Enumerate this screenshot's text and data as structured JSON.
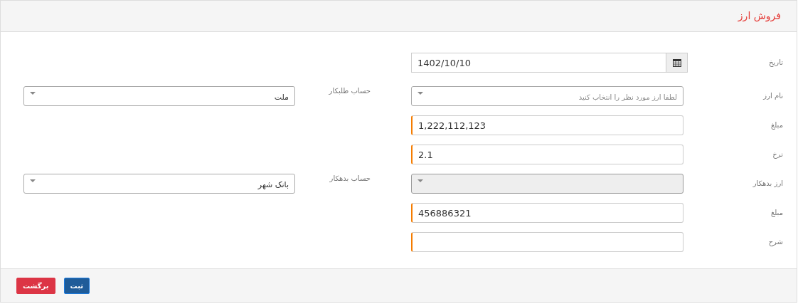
{
  "title": "فروش ارز",
  "rows": [
    {
      "label": "تاریخ",
      "field": {
        "kind": "date",
        "value": "1402/10/10",
        "required": false,
        "disabled": false
      }
    },
    {
      "label": "نام ارز",
      "field": {
        "kind": "select",
        "placeholder": "لطفا ارز مورد نظر را انتخاب کنید",
        "required": false,
        "disabled": false
      },
      "side": {
        "label": "حساب طلبکار",
        "value": "ملت"
      }
    },
    {
      "label": "مبلغ",
      "field": {
        "kind": "text",
        "value": "1,222,112,123",
        "required": true,
        "disabled": false
      }
    },
    {
      "label": "نرخ",
      "field": {
        "kind": "text",
        "value": "2.1",
        "required": true,
        "disabled": false
      }
    },
    {
      "label": "ارز بدهکار",
      "field": {
        "kind": "select",
        "required": false,
        "disabled": true
      },
      "side": {
        "label": "حساب بدهکار",
        "value": "بانک شهر"
      }
    },
    {
      "label": "مبلغ",
      "field": {
        "kind": "text",
        "value": "456886321",
        "required": true,
        "disabled": false
      }
    },
    {
      "label": "شرح",
      "field": {
        "kind": "text",
        "required": true,
        "disabled": false
      }
    }
  ],
  "buttons": [
    {
      "label": "ثبت",
      "kind": "primary"
    },
    {
      "label": "برگشت",
      "kind": "danger"
    }
  ]
}
